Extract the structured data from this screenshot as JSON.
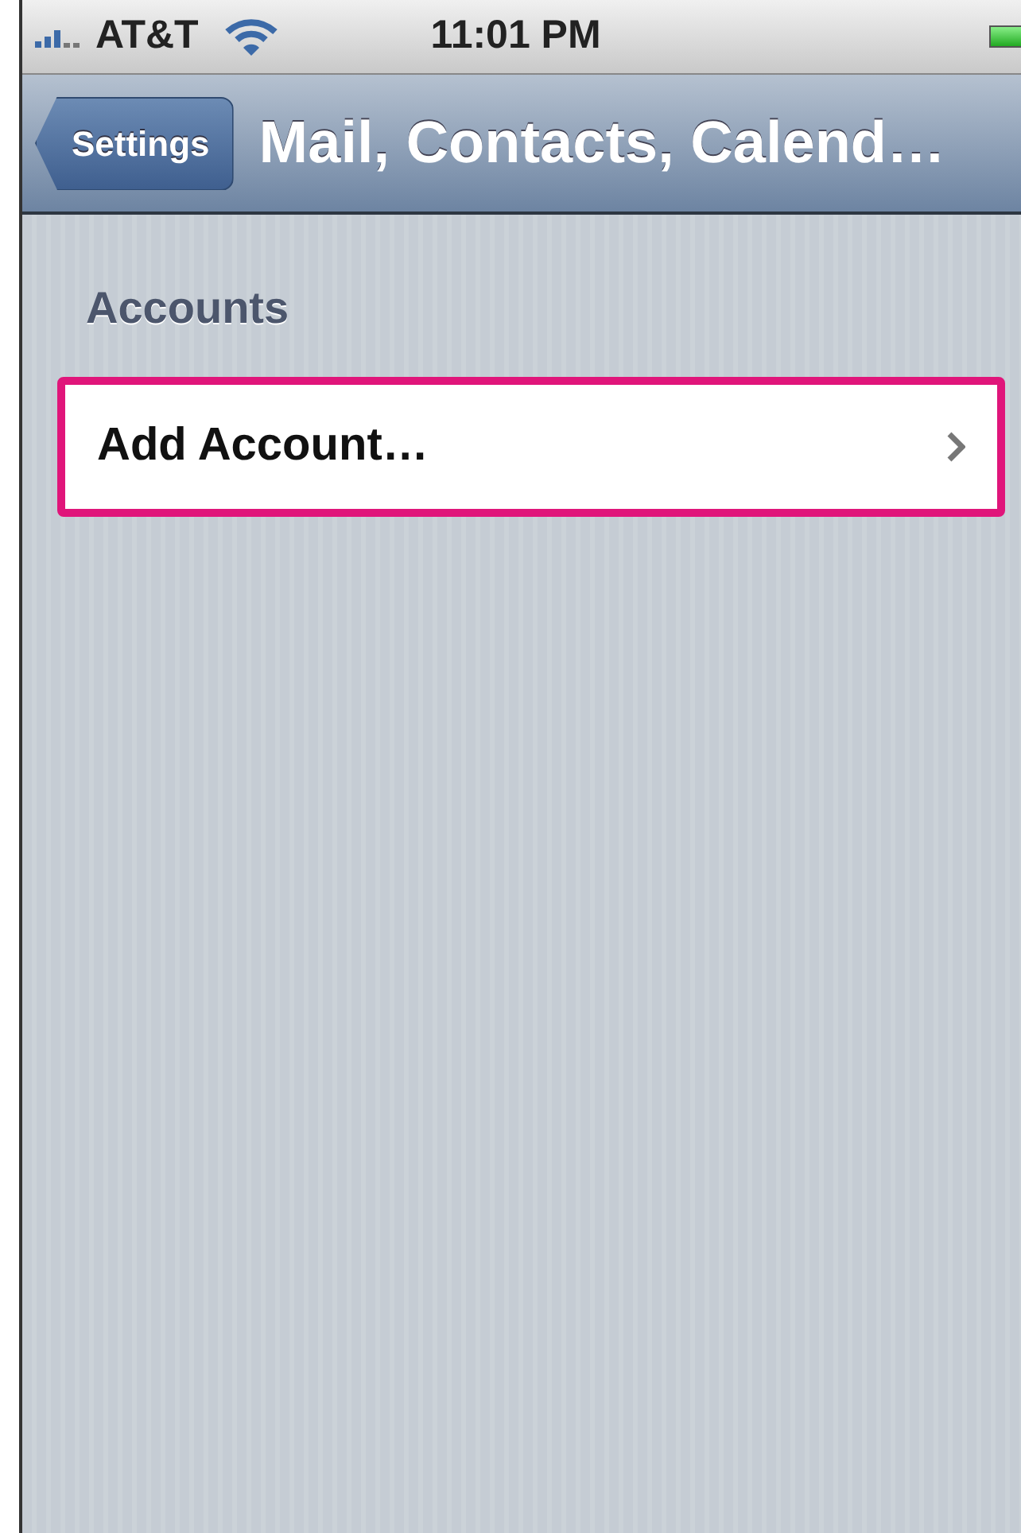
{
  "status_bar": {
    "carrier": "AT&T",
    "time": "11:01 PM"
  },
  "nav_bar": {
    "back_button": "Settings",
    "title": "Mail, Contacts, Calend…"
  },
  "sections": [
    {
      "header": "Accounts",
      "rows": [
        {
          "label": "Add Account…",
          "highlighted": true
        }
      ]
    }
  ]
}
